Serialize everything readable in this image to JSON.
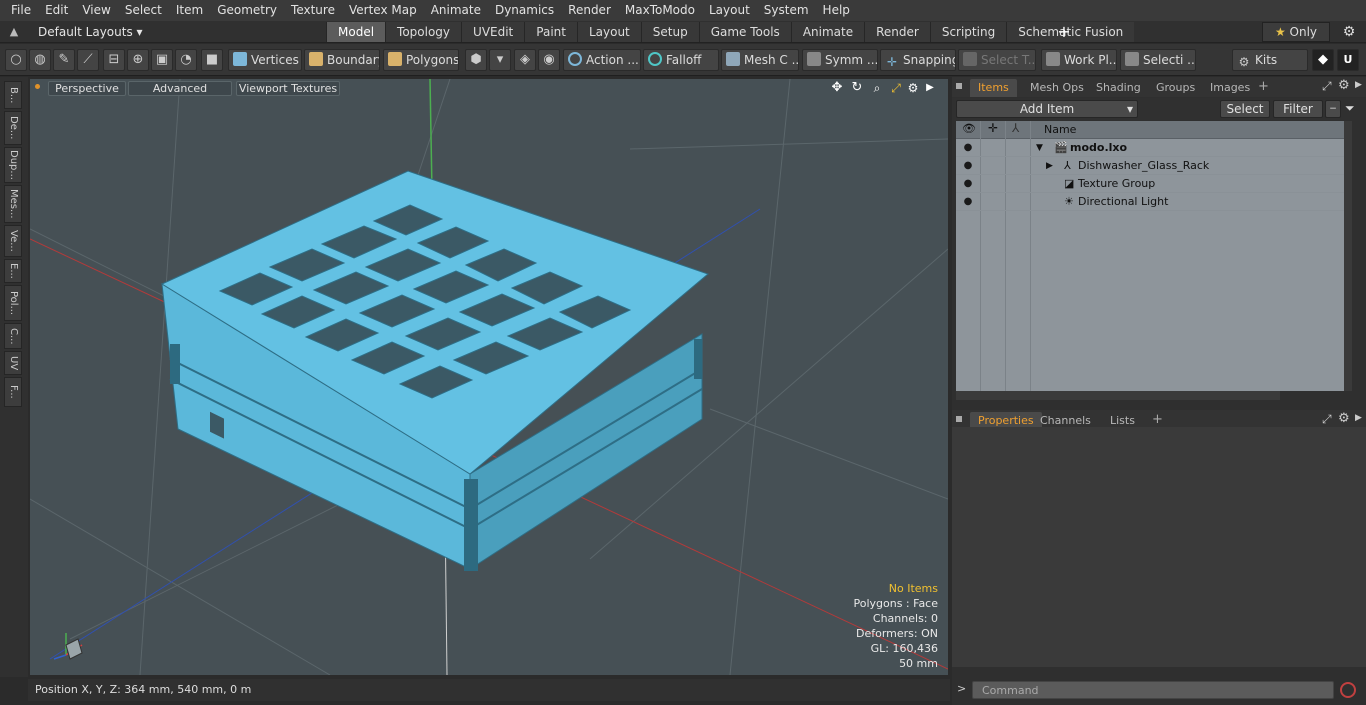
{
  "menu": [
    "File",
    "Edit",
    "View",
    "Select",
    "Item",
    "Geometry",
    "Texture",
    "Vertex Map",
    "Animate",
    "Dynamics",
    "Render",
    "MaxToModo",
    "Layout",
    "System",
    "Help"
  ],
  "layout": {
    "dropdown_label": "Default Layouts",
    "tabs": [
      "Model",
      "Topology",
      "UVEdit",
      "Paint",
      "Layout",
      "Setup",
      "Game Tools",
      "Animate",
      "Render",
      "Scripting",
      "Schematic Fusion"
    ],
    "active_tab": "Model",
    "only_label": "Only"
  },
  "toolbar": {
    "vertices": "Vertices",
    "boundary": "Boundary",
    "polygons": "Polygons",
    "action": "Action ...",
    "falloff": "Falloff",
    "mesh": "Mesh C ...",
    "symm": "Symm ...",
    "snapping": "Snapping",
    "select_t": "Select T...",
    "work_pl": "Work Pl...",
    "selecti": "Selecti ...",
    "kits": "Kits"
  },
  "leftstrip": [
    "B...",
    "De...",
    "Dup...",
    "Mes...",
    "Ve...",
    "E...",
    "Pol...",
    "C...",
    "UV",
    "F..."
  ],
  "viewport": {
    "perspective": "Perspective",
    "advanced": "Advanced",
    "viewport_textures": "Viewport Textures",
    "stats": {
      "no_items": "No Items",
      "polygons": "Polygons : Face",
      "channels": "Channels: 0",
      "deformers": "Deformers: ON",
      "gl": "GL: 160,436",
      "scale": "50 mm"
    },
    "model_color": "#5bb8da"
  },
  "status": {
    "position": "Position X, Y, Z:   364 mm, 540 mm, 0 m"
  },
  "items_panel": {
    "tabs": [
      "Items",
      "Mesh Ops",
      "Shading",
      "Groups",
      "Images"
    ],
    "active": "Items",
    "add_item": "Add Item",
    "select": "Select",
    "filter": "Filter",
    "name_header": "Name",
    "tree": [
      {
        "label": "modo.lxo",
        "bold": true
      },
      {
        "label": "Dishwasher_Glass_Rack"
      },
      {
        "label": "Texture Group"
      },
      {
        "label": "Directional Light"
      }
    ]
  },
  "props_panel": {
    "tabs": [
      "Properties",
      "Channels",
      "Lists"
    ],
    "active": "Properties"
  },
  "command": {
    "placeholder": "Command"
  }
}
